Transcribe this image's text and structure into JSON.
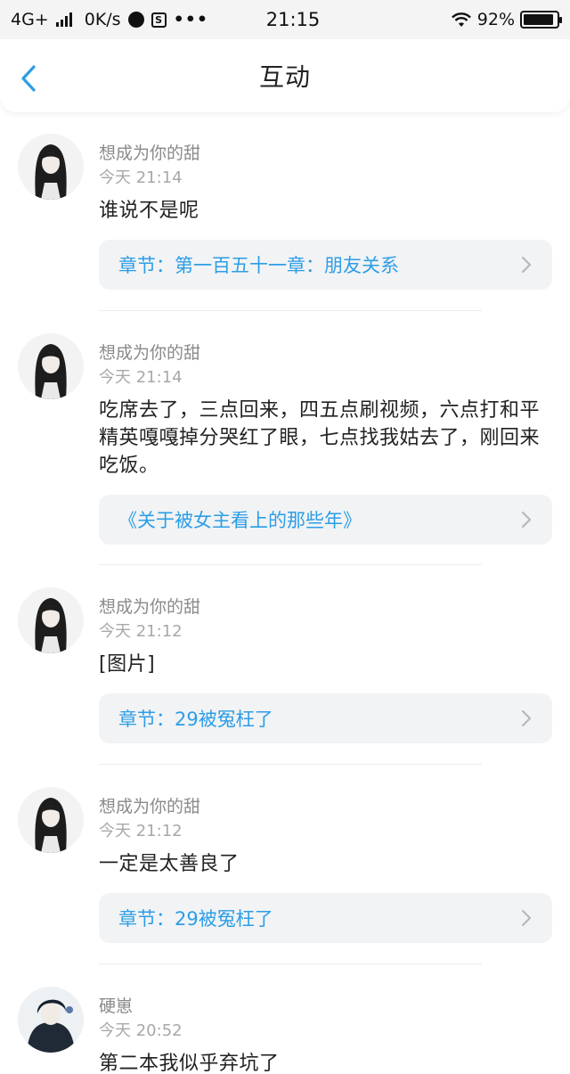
{
  "status_bar": {
    "network": "4G+",
    "speed": "0K/s",
    "time": "21:15",
    "battery": "92%",
    "battery_level": 0.92,
    "icons": [
      "signal-icon",
      "circle-app-icon",
      "s-app-icon",
      "more-dots-icon",
      "wifi-icon",
      "battery-icon"
    ]
  },
  "header": {
    "title": "互动",
    "back_icon": "chevron-left-icon",
    "accent_color": "#2c9ee6"
  },
  "items": [
    {
      "user": "想成为你的甜",
      "time": "今天 21:14",
      "content": "谁说不是呢",
      "link": "章节：第一百五十一章：朋友关系"
    },
    {
      "user": "想成为你的甜",
      "time": "今天 21:14",
      "content": "吃席去了，三点回来，四五点刷视频，六点打和平精英嘎嘎掉分哭红了眼，七点找我姑去了，刚回来吃饭。",
      "link": "《关于被女主看上的那些年》"
    },
    {
      "user": "想成为你的甜",
      "time": "今天 21:12",
      "content": "[图片]",
      "link": "章节：29被冤枉了"
    },
    {
      "user": "想成为你的甜",
      "time": "今天 21:12",
      "content": "一定是太善良了",
      "link": "章节：29被冤枉了"
    },
    {
      "user": "硬崽",
      "time": "今天 20:52",
      "content": "第二本我似乎弃坑了"
    }
  ]
}
